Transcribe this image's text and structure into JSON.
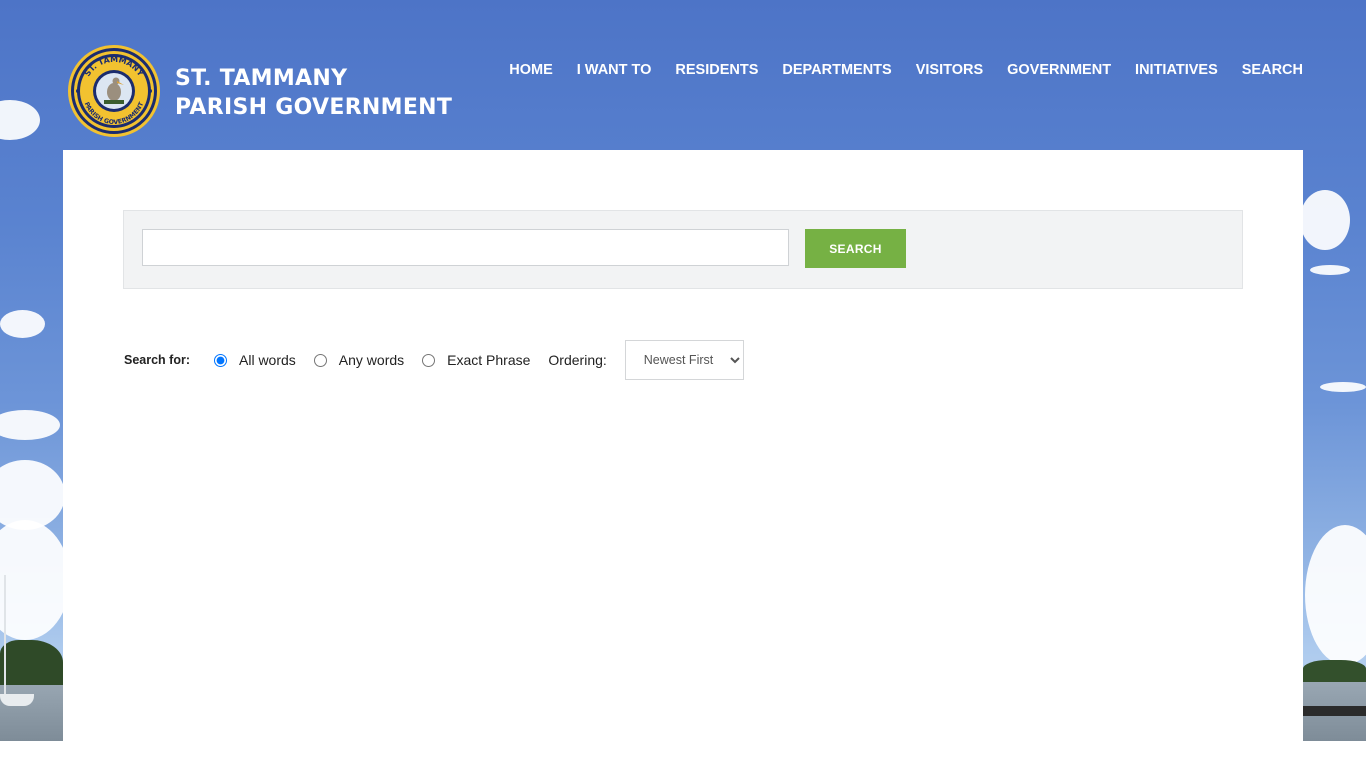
{
  "header": {
    "logo_text_top": "ST. TAMMANY",
    "logo_text_bottom": "PARISH GOVERNMENT",
    "title_line1": "ST. TAMMANY",
    "title_line2": "PARISH GOVERNMENT"
  },
  "nav": {
    "items": [
      {
        "label": "HOME"
      },
      {
        "label": "I WANT TO"
      },
      {
        "label": "RESIDENTS"
      },
      {
        "label": "DEPARTMENTS"
      },
      {
        "label": "VISITORS"
      },
      {
        "label": "GOVERNMENT"
      },
      {
        "label": "INITIATIVES"
      },
      {
        "label": "SEARCH"
      }
    ]
  },
  "search": {
    "input_value": "",
    "button_label": "SEARCH"
  },
  "options": {
    "search_for_label": "Search for:",
    "radios": [
      {
        "label": "All words",
        "checked": true
      },
      {
        "label": "Any words",
        "checked": false
      },
      {
        "label": "Exact Phrase",
        "checked": false
      }
    ],
    "ordering_label": "Ordering:",
    "ordering_selected": "Newest First"
  },
  "colors": {
    "search_button": "#76b144",
    "sky": "#5a83d0",
    "seal_gold": "#f2c230",
    "seal_navy": "#1b2c6e"
  }
}
